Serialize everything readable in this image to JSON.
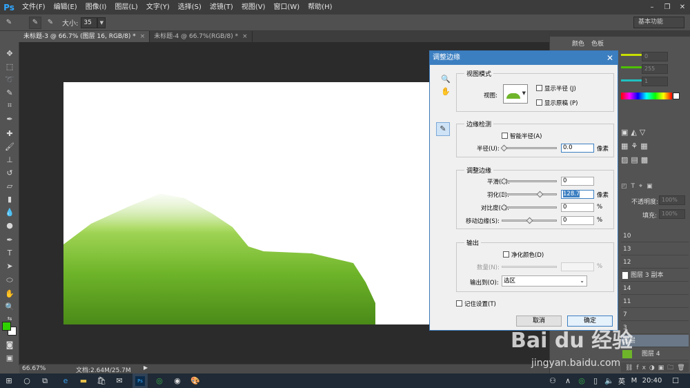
{
  "app": {
    "logo": "Ps"
  },
  "menu": [
    "文件(F)",
    "编辑(E)",
    "图像(I)",
    "图层(L)",
    "文字(Y)",
    "选择(S)",
    "滤镜(T)",
    "视图(V)",
    "窗口(W)",
    "帮助(H)"
  ],
  "options": {
    "size_label": "大小:",
    "size_value": "35",
    "workspace": "基本功能"
  },
  "tabs": [
    {
      "label": "未标题-3 @ 66.7% (图层 16, RGB/8) *",
      "close": "×"
    },
    {
      "label": "未标题-4 @ 66.7%(RGB/8) *",
      "close": "×"
    }
  ],
  "status": {
    "zoom": "66.67%",
    "doc": "文档:2.64M/25.7M"
  },
  "panels": {
    "tabs": [
      "颜色",
      "色板"
    ],
    "color_fields": [
      "0",
      "255",
      "1"
    ],
    "opacity_label": "不透明度:",
    "opacity_value": "100%",
    "fill_label": "填充:",
    "fill_value": "100%",
    "layers": [
      "10",
      "13",
      "12",
      "图层 3 副本",
      "14",
      "11",
      "7",
      "3",
      "图层",
      "图层 4"
    ]
  },
  "dialog": {
    "title": "调整边缘",
    "view_mode": {
      "group": "视图模式",
      "view_label": "视图:",
      "show_radius": "显示半径 (J)",
      "show_original": "显示原稿 (P)"
    },
    "edge_detection": {
      "group": "边缘检测",
      "smart_radius": "智能半径(A)",
      "radius_label": "半径(U):",
      "radius_value": "0.0",
      "radius_unit": "像素"
    },
    "adjust_edge": {
      "group": "调整边缘",
      "smooth_label": "平滑(H):",
      "smooth_value": "0",
      "feather_label": "羽化(E):",
      "feather_value": "128.7",
      "feather_unit": "像素",
      "contrast_label": "对比度(C):",
      "contrast_value": "0",
      "contrast_unit": "%",
      "shift_label": "移动边缘(S):",
      "shift_value": "0",
      "shift_unit": "%"
    },
    "output": {
      "group": "输出",
      "decontaminate": "净化颜色(D)",
      "amount_label": "数量(N):",
      "amount_unit": "%",
      "output_to_label": "输出到(O):",
      "output_to_value": "选区"
    },
    "remember": "记住设置(T)",
    "cancel": "取消",
    "ok": "确定"
  },
  "taskbar": {
    "ime": "英",
    "ime2": "M",
    "time": "20:40"
  },
  "watermark": {
    "brand": "Bai du 经验",
    "url": "jingyan.baidu.com"
  },
  "colors": {
    "fg": "#2fd000",
    "accent": "#3c7fc1"
  }
}
